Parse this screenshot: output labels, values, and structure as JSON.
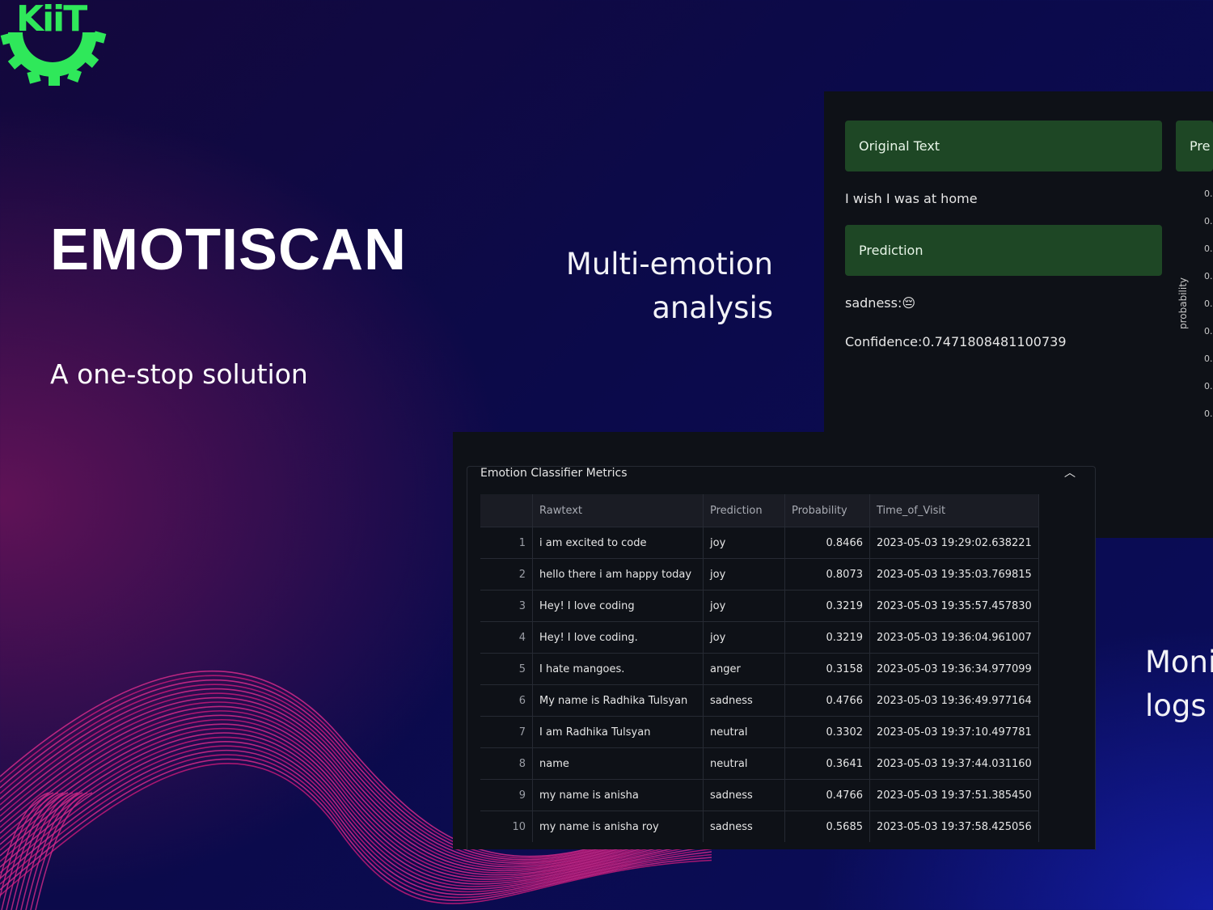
{
  "brand": {
    "logo_text": "KiiT",
    "accent": "#2fe85a"
  },
  "hero": {
    "title": "EMOTISCAN",
    "subtitle": "A one-stop solution"
  },
  "features": {
    "multi_line1": "Multi-emotion",
    "multi_line2": "analysis",
    "monitor_line1": "Moni",
    "monitor_line2": "logs"
  },
  "prediction_panel": {
    "original_text_header": "Original Text",
    "prediction_tab_cut": "Pre",
    "original_text_value": "I wish I was at home",
    "prediction_header": "Prediction",
    "prediction_value": "sadness:",
    "emoji": "😔",
    "confidence": "Confidence:0.7471808481100739",
    "chart_ylabel": "probability",
    "chart_ticks": [
      "0.",
      "0.",
      "0.",
      "0.",
      "0.",
      "0.",
      "0.",
      "0.",
      "0."
    ]
  },
  "metrics": {
    "title": "Emotion Classifier Metrics",
    "chevron": "^",
    "columns": [
      "",
      "Rawtext",
      "Prediction",
      "Probability",
      "Time_of_Visit"
    ],
    "rows": [
      [
        "1",
        "i am excited to code",
        "joy",
        "0.8466",
        "2023-05-03 19:29:02.638221"
      ],
      [
        "2",
        "hello there i am happy today",
        "joy",
        "0.8073",
        "2023-05-03 19:35:03.769815"
      ],
      [
        "3",
        "Hey! I love coding",
        "joy",
        "0.3219",
        "2023-05-03 19:35:57.457830"
      ],
      [
        "4",
        "Hey! I love coding.",
        "joy",
        "0.3219",
        "2023-05-03 19:36:04.961007"
      ],
      [
        "5",
        "I hate mangoes.",
        "anger",
        "0.3158",
        "2023-05-03 19:36:34.977099"
      ],
      [
        "6",
        "My name is Radhika Tulsyan",
        "sadness",
        "0.4766",
        "2023-05-03 19:36:49.977164"
      ],
      [
        "7",
        "I am Radhika Tulsyan",
        "neutral",
        "0.3302",
        "2023-05-03 19:37:10.497781"
      ],
      [
        "8",
        "name",
        "neutral",
        "0.3641",
        "2023-05-03 19:37:44.031160"
      ],
      [
        "9",
        "my name is anisha",
        "sadness",
        "0.4766",
        "2023-05-03 19:37:51.385450"
      ],
      [
        "10",
        "my name is anisha roy",
        "sadness",
        "0.5685",
        "2023-05-03 19:37:58.425056"
      ]
    ]
  }
}
